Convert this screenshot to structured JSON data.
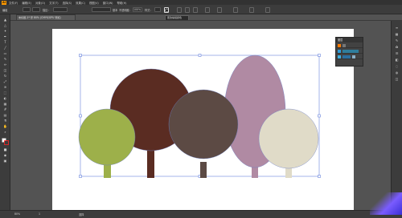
{
  "app": {
    "logo_text": "Ai"
  },
  "menu": {
    "items": [
      "文件(F)",
      "编辑(E)",
      "对象(O)",
      "文字(T)",
      "选择(S)",
      "效果(C)",
      "视图(V)",
      "窗口(W)",
      "帮助(H)"
    ]
  },
  "control_bar": {
    "group_label": "编组",
    "stroke_label": "描边：",
    "basic_label": "基本",
    "opacity_label": "不透明度：",
    "opacity_value": "100%",
    "style_label": "样式：",
    "active_tool_tooltip": "更改编组颜色"
  },
  "document": {
    "tab_title": "未标题-1* @ 80% (CMYK/GPU 预览)"
  },
  "status": {
    "zoom": "80%",
    "page": "1",
    "mode": "选择"
  },
  "layers_panel": {
    "title": "图层"
  },
  "colors": {
    "tree_green": "#9db04a",
    "tree_dark_brown": "#5a2c22",
    "tree_mid_brown": "#5c4a44",
    "tree_mauve": "#b08aa3",
    "tree_cream": "#e0dbc8",
    "selection_blue": "#4d6cd6"
  }
}
